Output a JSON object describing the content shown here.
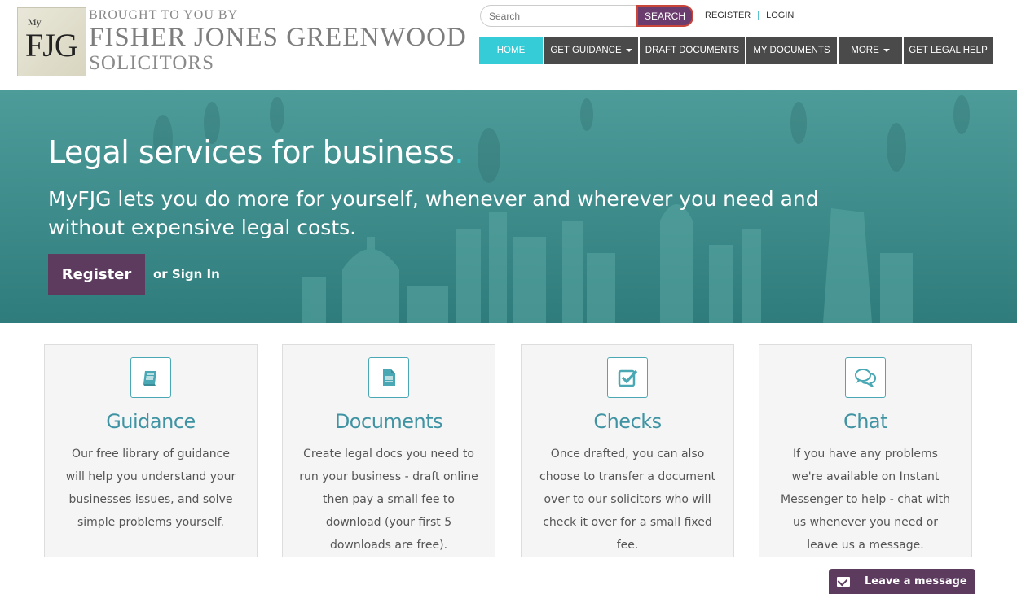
{
  "logo": {
    "my": "My",
    "fjg": "FJG",
    "line1": "BROUGHT TO YOU BY",
    "line2": "FISHER JONES GREENWOOD",
    "line3": "SOLICITORS"
  },
  "search": {
    "placeholder": "Search",
    "button": "SEARCH"
  },
  "top_links": {
    "register": "REGISTER",
    "separator": "|",
    "login": "LOGIN"
  },
  "nav": [
    {
      "label": "HOME",
      "active": true,
      "dropdown": false
    },
    {
      "label": "GET GUIDANCE",
      "active": false,
      "dropdown": true
    },
    {
      "label": "DRAFT DOCUMENTS",
      "active": false,
      "dropdown": false
    },
    {
      "label": "MY DOCUMENTS",
      "active": false,
      "dropdown": false
    },
    {
      "label": "MORE",
      "active": false,
      "dropdown": true
    },
    {
      "label": "GET LEGAL HELP",
      "active": false,
      "dropdown": false
    }
  ],
  "hero": {
    "title": "Legal services for business",
    "title_dot": ".",
    "subtitle": "MyFJG lets you do more for yourself, whenever and wherever you need and without expensive legal costs.",
    "register_button": "Register",
    "signin_text": "or Sign In"
  },
  "cards": [
    {
      "icon": "book-icon",
      "title": "Guidance",
      "text": "Our free library of guidance will help you understand your businesses issues, and solve simple problems yourself."
    },
    {
      "icon": "document-icon",
      "title": "Documents",
      "text": "Create legal docs you need to run your business - draft online then pay a small fee to download (your first 5 downloads are free)."
    },
    {
      "icon": "checkbox-icon",
      "title": "Checks",
      "text": "Once drafted, you can also choose to transfer a document over to our solicitors who will check it over for a small fixed fee."
    },
    {
      "icon": "chat-bubbles-icon",
      "title": "Chat",
      "text": "If you have any problems we're available on Instant Messenger to help - chat with us whenever you need or leave us a message."
    }
  ],
  "chat_widget": {
    "label": "Leave a message"
  },
  "colors": {
    "accent_teal": "#35ccd8",
    "brand_purple": "#5c3b5e",
    "nav_dark": "#4a4a4a",
    "card_title": "#3f93a3"
  }
}
